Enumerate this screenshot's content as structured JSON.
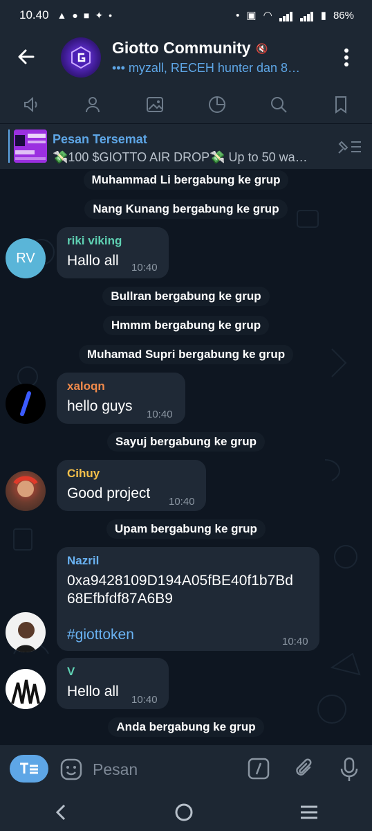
{
  "status_bar": {
    "time": "10.40",
    "battery": "86%"
  },
  "header": {
    "title": "Giotto Community",
    "subtitle": "••• myzall, RECEH hunter dan 8…"
  },
  "pinned": {
    "label": "Pesan Tersemat",
    "text": "💸100 $GIOTTO AIR DROP💸 Up to 50 wa…"
  },
  "messages": {
    "sys1": "Muhammad Li bergabung ke grup",
    "sys2": "Nang Kunang bergabung ke grup",
    "m1": {
      "initials": "RV",
      "sender": "riki viking",
      "text": "Hallo all",
      "time": "10:40"
    },
    "sys3": "Bullran bergabung ke grup",
    "sys4": "Hmmm bergabung ke grup",
    "sys5": "Muhamad Supri bergabung ke grup",
    "m2": {
      "sender": "xaloqn",
      "text": "hello guys",
      "time": "10:40"
    },
    "sys6": "Sayuj bergabung ke grup",
    "m3": {
      "sender": "Cihuy",
      "text": "Good project",
      "time": "10:40"
    },
    "sys7": "Upam bergabung ke grup",
    "m4": {
      "sender": "Nazril",
      "line1": "0xa9428109D194A05fBE40f1b7Bd",
      "line2": "68Efbfdf87A6B9",
      "hashtag": "#giottoken",
      "time": "10:40"
    },
    "m5": {
      "sender": "V",
      "text": "Hello all",
      "time": "10:40"
    },
    "sys8": "Anda bergabung ke grup"
  },
  "input": {
    "placeholder": "Pesan"
  },
  "colors": {
    "accent": "#5ea6e6",
    "bubble": "#1f2936",
    "bg": "#0e1621"
  }
}
